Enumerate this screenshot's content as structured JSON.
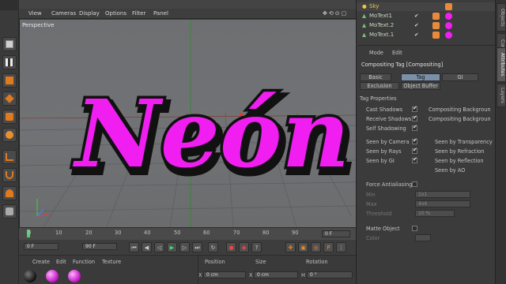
{
  "menubar": {
    "items": [
      "View",
      "Cameras",
      "Display",
      "Options",
      "Filter",
      "Panel"
    ]
  },
  "viewport": {
    "label": "Perspective",
    "text": "Neón",
    "text_color": "#f01ef0",
    "outline_color": "#111111"
  },
  "timeline": {
    "ticks": [
      "0",
      "10",
      "20",
      "30",
      "40",
      "50",
      "60",
      "70",
      "80",
      "90"
    ],
    "end_field": "0 F"
  },
  "transport": {
    "start_field": "0 F",
    "end_field": "90 F"
  },
  "material_manager": {
    "menu": [
      "Create",
      "Edit",
      "Function",
      "Texture"
    ]
  },
  "coordinates": {
    "headers": [
      "Position",
      "Size",
      "Rotation"
    ],
    "row_label": "X",
    "position_x": "0 cm",
    "size_x": "0 cm",
    "rotation_label": "H",
    "rotation_h": "0 °"
  },
  "object_manager": {
    "objects": [
      {
        "name": "Sky",
        "color": "#e8c84a"
      },
      {
        "name": "MoText1",
        "color": "#a8d8a8"
      },
      {
        "name": "MoText.2",
        "color": "#a8d8a8"
      },
      {
        "name": "MoText.1",
        "color": "#a8d8a8"
      }
    ]
  },
  "attributes": {
    "menu": [
      "Mode",
      "Edit"
    ],
    "title": "Compositing Tag [Compositing]",
    "tabs": [
      "Basic",
      "Tag",
      "GI"
    ],
    "tabs2": [
      "Exclusion",
      "Object Buffer"
    ],
    "section": "Tag Properties",
    "left_props": [
      {
        "label": "Cast Shadows",
        "checked": true
      },
      {
        "label": "Receive Shadows",
        "checked": true
      },
      {
        "label": "Self Shadowing",
        "checked": true
      },
      {
        "label": "Seen by Camera",
        "checked": true
      },
      {
        "label": "Seen by Rays",
        "checked": true
      },
      {
        "label": "Seen by GI",
        "checked": true
      }
    ],
    "right_props": [
      {
        "label": "Compositing Backgroun"
      },
      {
        "label": "Compositing Backgroun"
      },
      {
        "label": "Seen by Transparency"
      },
      {
        "label": "Seen by Refraction"
      },
      {
        "label": "Seen by Reflection"
      },
      {
        "label": "Seen by AO"
      }
    ],
    "force_aa": "Force Antialiasing",
    "min_label": "Min",
    "min_value": "1x1",
    "max_label": "Max",
    "max_value": "4x4",
    "threshold_label": "Threshold",
    "threshold_value": "10 %",
    "matte": "Matte Object",
    "color_label": "Color"
  },
  "right_tabs": [
    "Objects",
    "Content",
    "Attributes",
    "Layers"
  ]
}
